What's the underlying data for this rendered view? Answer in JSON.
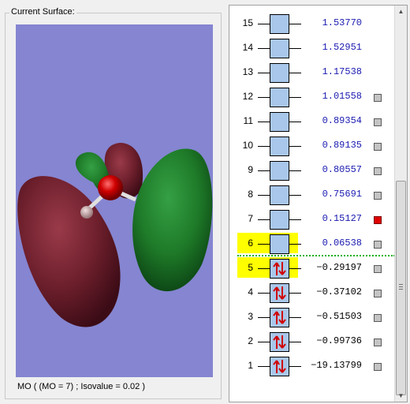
{
  "surface_panel": {
    "title": "Current Surface:",
    "caption": "MO ( (MO = 7) ; Isovalue = 0.02 )",
    "colors": {
      "background": "#8585d1",
      "positive_lobe": "#6d1f2c",
      "negative_lobe": "#1e7a28",
      "oxygen": "#d00000",
      "hydrogen": "#c9a6a8"
    }
  },
  "mo_list": {
    "homo_lumo_highlight_color": "#ffff00",
    "rows": [
      {
        "index": "15",
        "energy": "1.53770",
        "occupancy": "virtual",
        "checkbox": "none",
        "highlight": false
      },
      {
        "index": "14",
        "energy": "1.52951",
        "occupancy": "virtual",
        "checkbox": "none",
        "highlight": false
      },
      {
        "index": "13",
        "energy": "1.17538",
        "occupancy": "virtual",
        "checkbox": "none",
        "highlight": false
      },
      {
        "index": "12",
        "energy": "1.01558",
        "occupancy": "virtual",
        "checkbox": "unchecked",
        "highlight": false
      },
      {
        "index": "11",
        "energy": "0.89354",
        "occupancy": "virtual",
        "checkbox": "unchecked",
        "highlight": false
      },
      {
        "index": "10",
        "energy": "0.89135",
        "occupancy": "virtual",
        "checkbox": "unchecked",
        "highlight": false
      },
      {
        "index": "9",
        "energy": "0.80557",
        "occupancy": "virtual",
        "checkbox": "unchecked",
        "highlight": false
      },
      {
        "index": "8",
        "energy": "0.75691",
        "occupancy": "virtual",
        "checkbox": "unchecked",
        "highlight": false
      },
      {
        "index": "7",
        "energy": "0.15127",
        "occupancy": "virtual",
        "checkbox": "checked",
        "highlight": false
      },
      {
        "index": "6",
        "energy": "0.06538",
        "occupancy": "virtual",
        "checkbox": "unchecked",
        "highlight": true
      },
      {
        "index": "5",
        "energy": "−0.29197",
        "occupancy": "occupied",
        "checkbox": "unchecked",
        "highlight": true
      },
      {
        "index": "4",
        "energy": "−0.37102",
        "occupancy": "occupied",
        "checkbox": "unchecked",
        "highlight": false
      },
      {
        "index": "3",
        "energy": "−0.51503",
        "occupancy": "occupied",
        "checkbox": "unchecked",
        "highlight": false
      },
      {
        "index": "2",
        "energy": "−0.99736",
        "occupancy": "occupied",
        "checkbox": "unchecked",
        "highlight": false
      },
      {
        "index": "1",
        "energy": "−19.13799",
        "occupancy": "occupied",
        "checkbox": "unchecked",
        "highlight": false
      }
    ]
  },
  "scrollbar": {
    "up_icon": "arrow-up-icon",
    "down_icon": "arrow-down-icon"
  }
}
